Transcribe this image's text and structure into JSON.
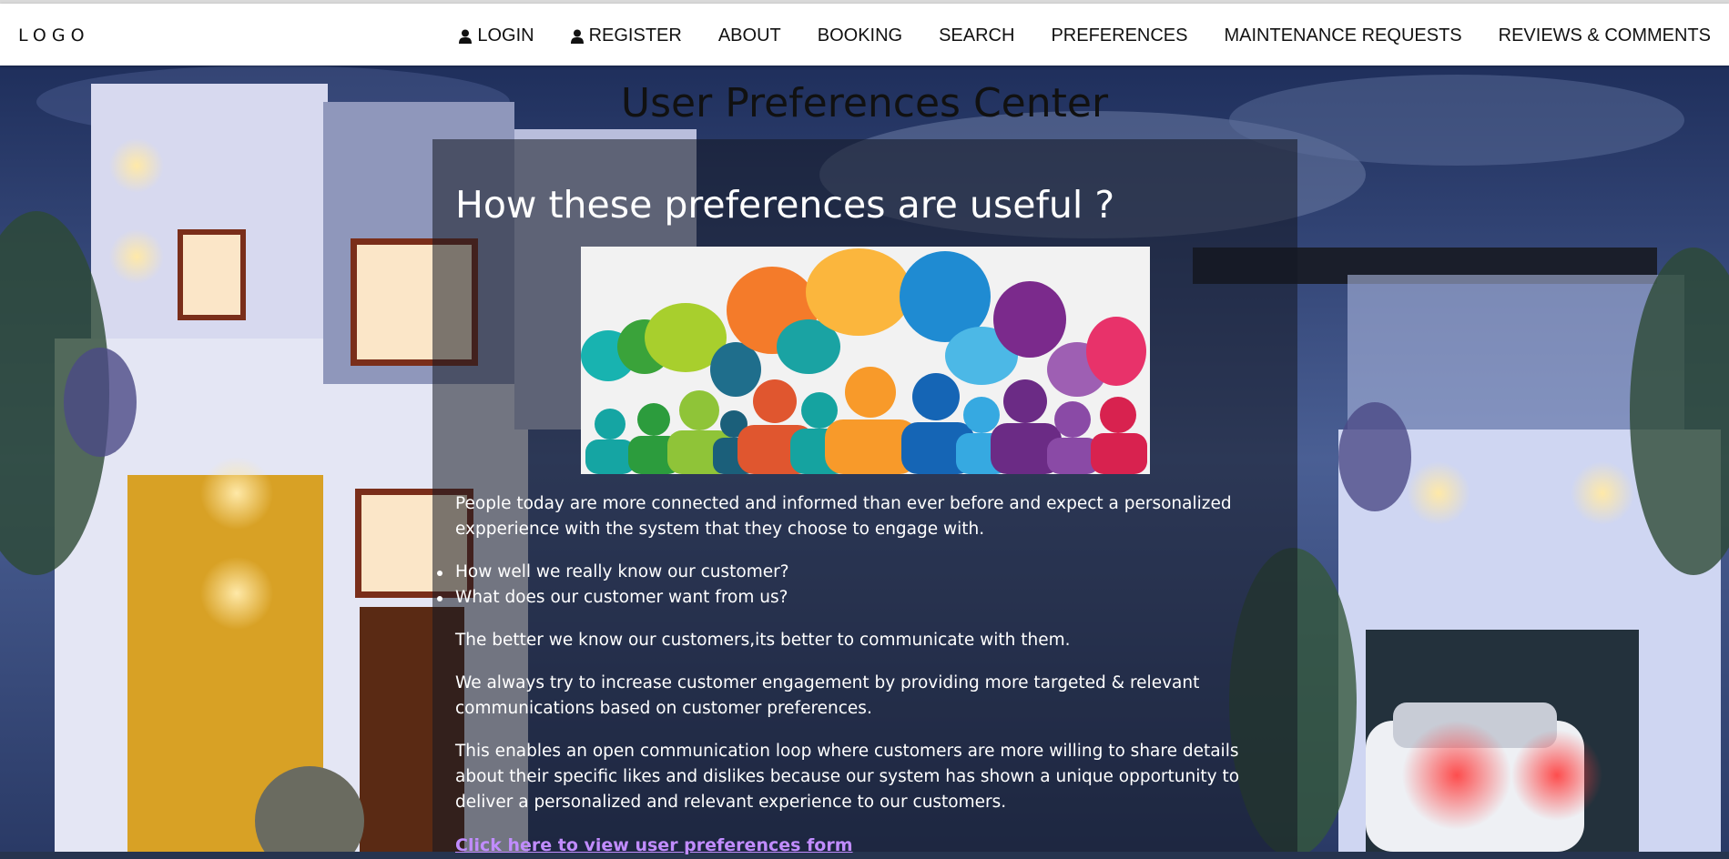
{
  "header": {
    "logo": "LOGO",
    "nav": [
      {
        "label": "LOGIN",
        "icon": "user-icon"
      },
      {
        "label": "REGISTER",
        "icon": "user-icon"
      },
      {
        "label": "ABOUT"
      },
      {
        "label": "BOOKING"
      },
      {
        "label": "SEARCH"
      },
      {
        "label": "PREFERENCES"
      },
      {
        "label": "MAINTENANCE REQUESTS"
      },
      {
        "label": "REVIEWS & COMMENTS"
      }
    ]
  },
  "main": {
    "title": "User Preferences Center",
    "heading": "How these preferences are useful ?",
    "image_icon": "speech-bubbles-people-illustration",
    "intro": "People today are more connected and informed than ever before and expect a personalized expperience with the system that they choose to engage with.",
    "questions": [
      "How well we really know our customer?",
      "What does our customer want from us?"
    ],
    "paragraph2": "The better we know our customers,its better to communicate with them.",
    "paragraph3": "We always try to increase customer engagement by providing more targeted & relevant communications based on customer preferences.",
    "paragraph4": "This enables an open communication loop where customers are more willing to share details about their specific likes and dislikes because our system has shown a unique opportunity to deliver a personalized and relevant experience to our customers.",
    "link_text": "Click here to view user preferences form"
  },
  "colors": {
    "navbar_bg": "#ffffff",
    "panel_bg": "rgba(20,24,34,0.55)",
    "link": "#c18cff",
    "sky": "#2c3e6e"
  }
}
